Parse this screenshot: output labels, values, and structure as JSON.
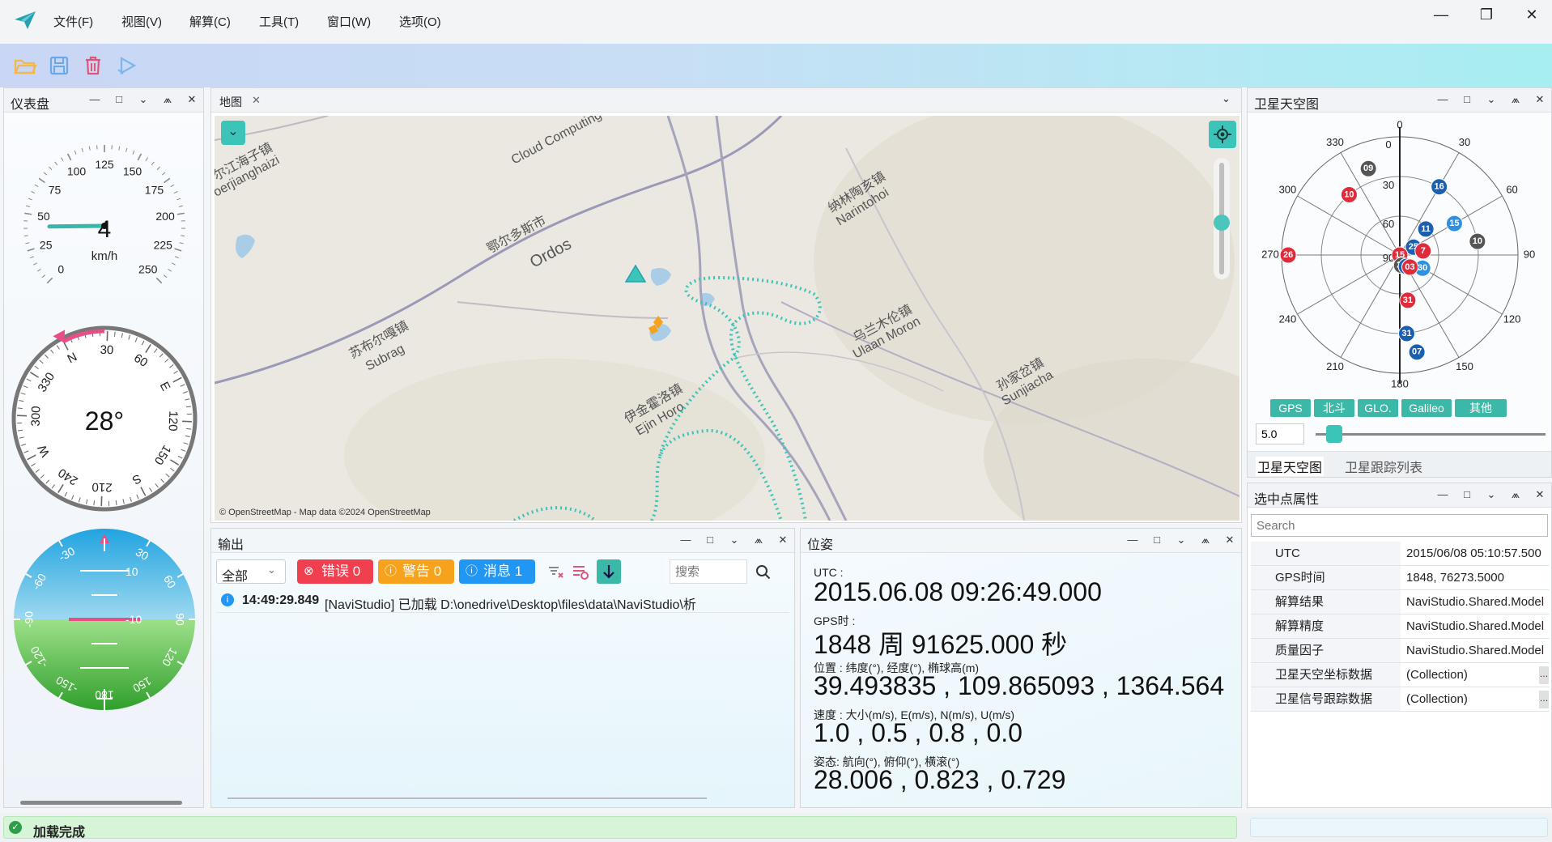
{
  "menu": {
    "items": [
      "文件(F)",
      "视图(V)",
      "解算(C)",
      "工具(T)",
      "窗口(W)",
      "选项(O)"
    ],
    "window_controls": [
      "minimize",
      "maximize",
      "close"
    ]
  },
  "toolbar": {
    "icons": [
      "open-folder-icon",
      "save-icon",
      "delete-icon",
      "play-icon"
    ],
    "colors": {
      "open": "#f2b84b",
      "save": "#6aa9e8",
      "delete": "#e0567a",
      "play": "#7db6e8"
    }
  },
  "dashboard": {
    "title": "仪表盘",
    "speedometer": {
      "value": "4",
      "unit": "km/h",
      "ticks": [
        "0",
        "25",
        "50",
        "75",
        "100",
        "125",
        "150",
        "175",
        "200",
        "225",
        "250"
      ],
      "needle_value": 4
    },
    "compass": {
      "heading": "28°",
      "heading_value": 28,
      "labels": [
        "N",
        "30",
        "60",
        "E",
        "120",
        "150",
        "S",
        "210",
        "240",
        "W",
        "300",
        "330"
      ]
    },
    "attitude": {
      "pitch_labels": [
        "10",
        "-10"
      ],
      "roll_labels": [
        "30",
        "60",
        "90",
        "120",
        "150",
        "180",
        "-30",
        "-60",
        "-90",
        "-120",
        "-150"
      ]
    }
  },
  "map": {
    "tab": "地图",
    "attribution": "© OpenStreetMap - Map data ©2024 OpenStreetMap",
    "labels": [
      {
        "cn": "鄂尔多斯市",
        "en": "Ordos"
      },
      {
        "cn": "纳林陶亥镇",
        "en": "Narintohoi"
      },
      {
        "cn": "苏布尔嘎镇",
        "en": "Subrag"
      },
      {
        "cn": "乌兰木伦镇",
        "en": "Ulaan Moron"
      },
      {
        "cn": "伊金霍洛镇",
        "en": "Ejin Horo"
      },
      {
        "cn": "孙家岔镇",
        "en": "Sunjiacha"
      },
      {
        "cn": "尔江海子镇",
        "en": "oerjianghaizi"
      },
      {
        "cn": "",
        "en": "Cloud Computing"
      }
    ]
  },
  "output": {
    "title": "输出",
    "filter": "全部",
    "error_label": "错误 0",
    "warning_label": "警告 0",
    "message_label": "消息 1",
    "search_placeholder": "搜索",
    "log": {
      "time": "14:49:29.849",
      "text": "[NaviStudio] 已加载 D:\\onedrive\\Desktop\\files\\data\\NaviStudio\\析"
    },
    "colors": {
      "error": "#f04050",
      "warning": "#f6a21c",
      "message": "#2196f3"
    }
  },
  "pose": {
    "title": "位姿",
    "utc_label": "UTC :",
    "utc_value": "2015.06.08 09:26:49.000",
    "gps_label": "GPS时 :",
    "gps_value": "1848 周 91625.000 秒",
    "pos_label": "位置 : 纬度(°), 经度(°), 椭球高(m)",
    "pos_value": "39.493835 , 109.865093 , 1364.564",
    "vel_label": "速度 : 大小(m/s), E(m/s), N(m/s), U(m/s)",
    "vel_value": "1.0 , 0.5 , 0.8 , 0.0",
    "att_label": "姿态:  航向(°), 俯仰(°), 横滚(°)",
    "att_value": "28.006 , 0.823 , 0.729"
  },
  "sky": {
    "title": "卫星天空图",
    "azimuth_labels": [
      "0",
      "30",
      "60",
      "90",
      "120",
      "150",
      "180",
      "210",
      "240",
      "270",
      "300",
      "330"
    ],
    "elevation_labels": [
      "0",
      "30",
      "60",
      "90"
    ],
    "satellites": [
      {
        "id": "09",
        "color": "#555555"
      },
      {
        "id": "10",
        "color": "#e02b3a"
      },
      {
        "id": "16",
        "color": "#1b5fb0"
      },
      {
        "id": "15",
        "color": "#2f8fe0"
      },
      {
        "id": "11",
        "color": "#1b5fb0"
      },
      {
        "id": "10",
        "color": "#555555"
      },
      {
        "id": "25",
        "color": "#1b5fb0"
      },
      {
        "id": "7",
        "color": "#e02b3a"
      },
      {
        "id": "15",
        "color": "#e02b3a"
      },
      {
        "id": "26",
        "color": "#e02b3a"
      },
      {
        "id": "24",
        "color": "#555555"
      },
      {
        "id": "20",
        "color": "#1b5fb0"
      },
      {
        "id": "30",
        "color": "#2f8fe0"
      },
      {
        "id": "31",
        "color": "#e02b3a"
      },
      {
        "id": "31",
        "color": "#1b5fb0"
      },
      {
        "id": "07",
        "color": "#1b5fb0"
      },
      {
        "id": "03",
        "color": "#e02b3a"
      }
    ],
    "filters": [
      "GPS",
      "北斗",
      "GLO.",
      "Galileo",
      "其他"
    ],
    "elevation_mask": "5.0",
    "mask_fraction": 0.05,
    "tabs": [
      "卫星天空图",
      "卫星跟踪列表"
    ]
  },
  "props": {
    "title": "选中点属性",
    "search_placeholder": "Search",
    "rows": [
      {
        "key": "UTC",
        "value": "2015/06/08 05:10:57.500",
        "expandable": false
      },
      {
        "key": "GPS时间",
        "value": "1848, 76273.5000",
        "expandable": true
      },
      {
        "key": "解算结果",
        "value": "NaviStudio.Shared.Model",
        "expandable": true
      },
      {
        "key": "解算精度",
        "value": "NaviStudio.Shared.Model",
        "expandable": true
      },
      {
        "key": "质量因子",
        "value": "NaviStudio.Shared.Model",
        "expandable": true
      },
      {
        "key": "卫星天空坐标数据",
        "value": "(Collection)",
        "expandable": false
      },
      {
        "key": "卫星信号跟踪数据",
        "value": "(Collection)",
        "expandable": false
      }
    ]
  },
  "status": {
    "text": "加载完成",
    "ok_color": "#2e9e4a"
  }
}
